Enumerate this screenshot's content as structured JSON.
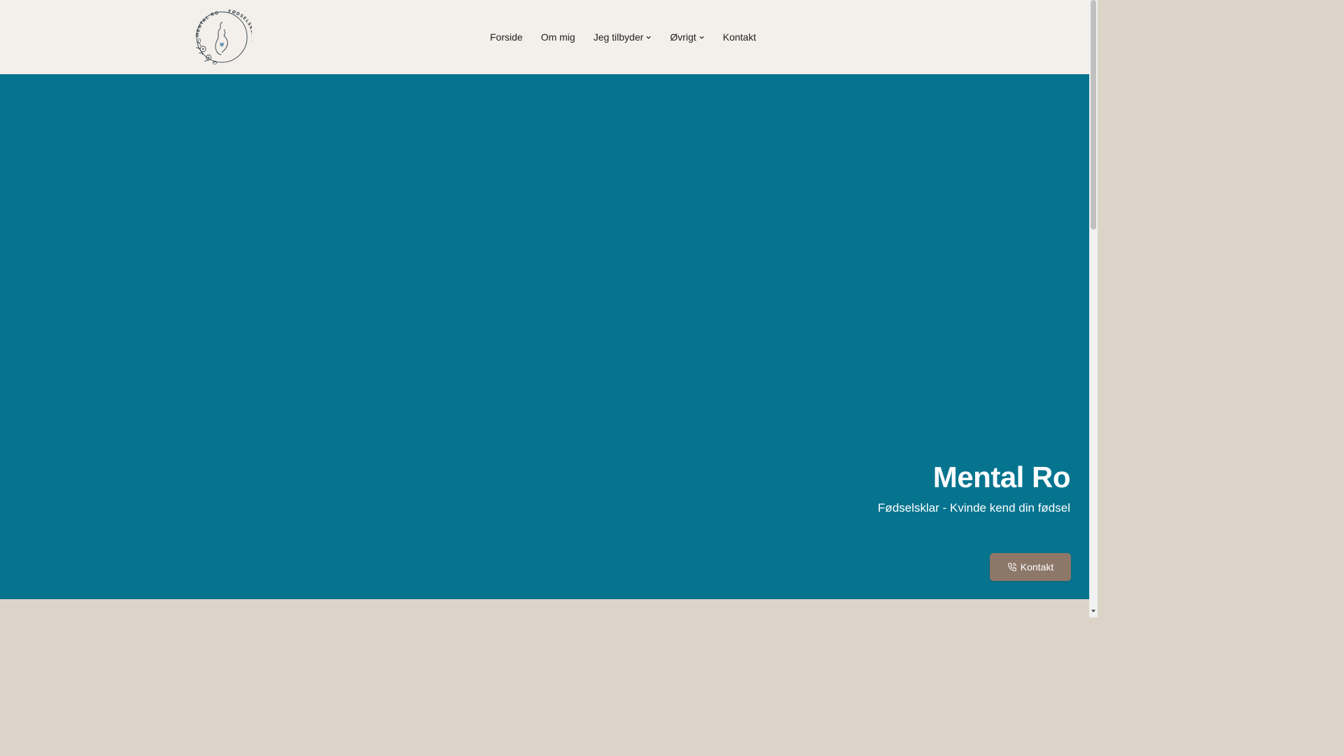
{
  "header": {
    "logo": {
      "text_top": "MENTAL RO",
      "text_right": "FØDSELSKLAR",
      "icon": "pregnant-woman-floral-wreath-logo",
      "colors": {
        "line": "#3d4a52",
        "heart": "#6f9bb5"
      }
    },
    "nav": {
      "items": [
        {
          "label": "Forside",
          "has_dropdown": false
        },
        {
          "label": "Om mig",
          "has_dropdown": false
        },
        {
          "label": "Jeg tilbyder",
          "has_dropdown": true
        },
        {
          "label": "Øvrigt",
          "has_dropdown": true
        },
        {
          "label": "Kontakt",
          "has_dropdown": false
        }
      ]
    },
    "background": "#f3f0eb"
  },
  "hero": {
    "title": "Mental Ro",
    "subtitle": "Fødselsklar - Kvinde kend din fødsel",
    "cta": {
      "label": "Kontakt",
      "icon": "phone-icon"
    },
    "background": "#06748f",
    "cta_color": "#8c7768"
  },
  "footer_strip_color": "#ddd4c9"
}
